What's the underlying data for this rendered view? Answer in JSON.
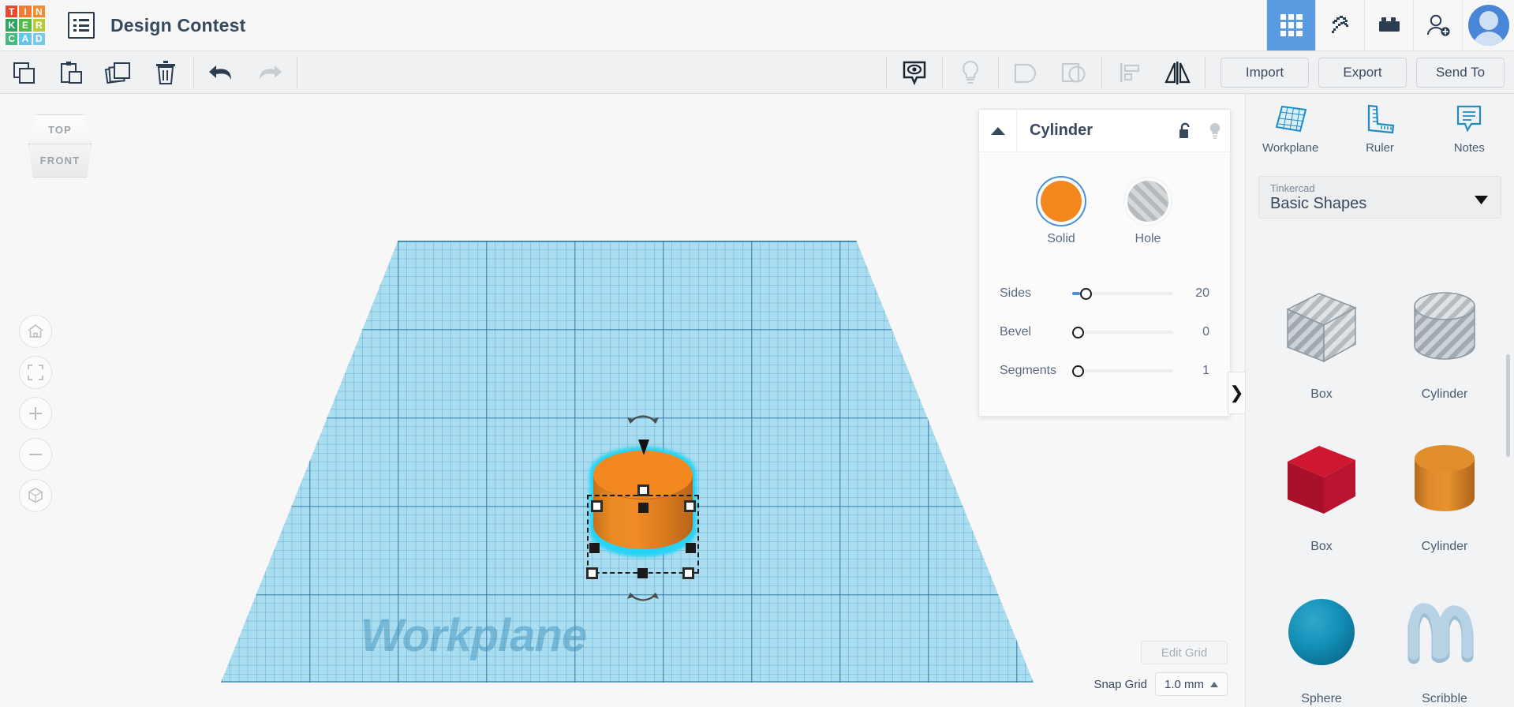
{
  "app": {
    "logo_letters": [
      {
        "ch": "T",
        "color": "#e8492e"
      },
      {
        "ch": "I",
        "color": "#f37a35"
      },
      {
        "ch": "N",
        "color": "#f58a2e"
      },
      {
        "ch": "K",
        "color": "#2fa560"
      },
      {
        "ch": "E",
        "color": "#57b94a"
      },
      {
        "ch": "R",
        "color": "#b6cc3a"
      },
      {
        "ch": "C",
        "color": "#46b97e"
      },
      {
        "ch": "A",
        "color": "#63c6e8"
      },
      {
        "ch": "D",
        "color": "#7ac9ea"
      }
    ],
    "document_title": "Design Contest",
    "dashboard_icon": "document-list-icon"
  },
  "topbar_right": {
    "items": [
      {
        "name": "blocks-grid-icon",
        "active": true
      },
      {
        "name": "minecraft-pickaxe-icon",
        "active": false
      },
      {
        "name": "lego-brick-icon",
        "active": false
      },
      {
        "name": "invite-person-icon",
        "active": false
      }
    ],
    "avatar_name": "user-avatar"
  },
  "toolbar": {
    "left_tools": [
      {
        "name": "copy-button",
        "label": "Copy",
        "enabled": true
      },
      {
        "name": "paste-button",
        "label": "Paste",
        "enabled": true
      },
      {
        "name": "duplicate-button",
        "label": "Duplicate",
        "enabled": true
      },
      {
        "name": "delete-button",
        "label": "Delete",
        "enabled": true
      }
    ],
    "history_tools": [
      {
        "name": "undo-button",
        "label": "Undo",
        "enabled": true
      },
      {
        "name": "redo-button",
        "label": "Redo",
        "enabled": false
      }
    ],
    "right_tools": [
      {
        "name": "visibility-button",
        "label": "Show/Hide",
        "enabled": true
      },
      {
        "name": "lightbulb-button",
        "label": "Light",
        "enabled": false
      },
      {
        "name": "group-button",
        "label": "Group",
        "enabled": false
      },
      {
        "name": "ungroup-button",
        "label": "Ungroup",
        "enabled": false
      },
      {
        "name": "align-button",
        "label": "Align",
        "enabled": false
      },
      {
        "name": "mirror-button",
        "label": "Mirror",
        "enabled": true
      }
    ],
    "import_label": "Import",
    "export_label": "Export",
    "sendto_label": "Send To"
  },
  "viewport": {
    "viewcube": {
      "top_label": "TOP",
      "front_label": "FRONT"
    },
    "nav_buttons": [
      {
        "name": "home-view-button",
        "label": "Home view"
      },
      {
        "name": "fit-to-view-button",
        "label": "Fit all in view"
      },
      {
        "name": "zoom-in-button",
        "label": "Zoom in"
      },
      {
        "name": "zoom-out-button",
        "label": "Zoom out"
      },
      {
        "name": "perspective-toggle-button",
        "label": "Switch to orthographic view"
      }
    ],
    "workplane_label": "Workplane",
    "collapse_chevron": "❯",
    "edit_grid_label": "Edit Grid",
    "snap_grid_label": "Snap Grid",
    "snap_grid_value": "1.0 mm",
    "selected_object": "Cylinder"
  },
  "properties": {
    "title": "Cylinder",
    "lock_icon": "unlock-icon",
    "light_icon": "lightbulb-icon",
    "collapse_icon": "caret-up-icon",
    "modes": [
      {
        "name": "solid-mode",
        "label": "Solid",
        "selected": true,
        "color": "#f2871e"
      },
      {
        "name": "hole-mode",
        "label": "Hole",
        "selected": false,
        "color": "#b6babd"
      }
    ],
    "sliders": [
      {
        "name": "sides-slider",
        "label": "Sides",
        "value": "20",
        "knob_pct": 14,
        "fill_pct": 8
      },
      {
        "name": "bevel-slider",
        "label": "Bevel",
        "value": "0",
        "knob_pct": 0,
        "fill_pct": 0
      },
      {
        "name": "segments-slider",
        "label": "Segments",
        "value": "1",
        "knob_pct": 0,
        "fill_pct": 0
      }
    ]
  },
  "right_panel": {
    "tools": [
      {
        "name": "workplane-tool",
        "label": "Workplane"
      },
      {
        "name": "ruler-tool",
        "label": "Ruler"
      },
      {
        "name": "notes-tool",
        "label": "Notes"
      }
    ],
    "library_source": "Tinkercad",
    "library_name": "Basic Shapes",
    "shapes": [
      {
        "name": "shape-hole-box",
        "label": "Box",
        "kind": "box",
        "style": "hole"
      },
      {
        "name": "shape-hole-cylinder",
        "label": "Cylinder",
        "kind": "cylinder",
        "style": "hole"
      },
      {
        "name": "shape-red-box",
        "label": "Box",
        "kind": "box",
        "style": "solid",
        "color": "#c4142a"
      },
      {
        "name": "shape-orange-cylinder",
        "label": "Cylinder",
        "kind": "cylinder",
        "style": "solid",
        "color": "#e0882b"
      },
      {
        "name": "shape-sphere",
        "label": "Sphere",
        "kind": "sphere",
        "style": "solid",
        "color": "#128fb5"
      },
      {
        "name": "shape-scribble",
        "label": "Scribble",
        "kind": "scribble",
        "style": "solid",
        "color": "#9dbfd6"
      }
    ]
  },
  "colors": {
    "accent_blue": "#4a90d9",
    "solid_orange": "#f2871e",
    "workplane_blue": "#a9ddef",
    "selection_cyan": "#27d3f5",
    "text_dark": "#39495d"
  }
}
